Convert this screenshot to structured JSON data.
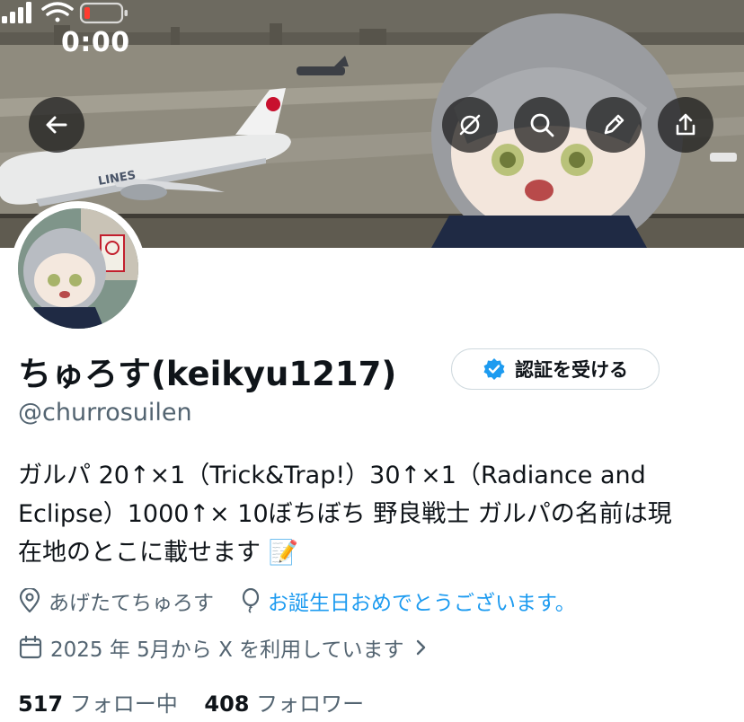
{
  "status_bar": {
    "time": "0:00",
    "icons": [
      "signal-icon",
      "wifi-icon",
      "battery-low-icon"
    ]
  },
  "header_actions": {
    "back": "back-arrow-icon",
    "grok": "grok-icon",
    "search": "search-icon",
    "edit": "pencil-icon",
    "share": "share-icon"
  },
  "banner_plane_text": "LINES",
  "profile": {
    "display_name": "ちゅろす(keikyu1217)",
    "handle": "@churrosuilen",
    "verify_label": "認証を受ける",
    "bio_lines": [
      "ガルパ 20↑×1（Trick&Trap!）30↑×1（Radiance and",
      "Eclipse）1000↑× 10ぼちぼち 野良戦士 ガルパの名前は現",
      "在地のとこに載せます 📝"
    ],
    "location": "あげたてちゅろす",
    "birthday": "お誕生日おめでとうございます。",
    "joined": "2025 年 5月から X を利用しています",
    "following_count": "517",
    "following_label": "フォロー中",
    "followers_count": "408",
    "followers_label": "フォロワー"
  },
  "colors": {
    "accent": "#1d9bf0",
    "secondary_text": "#536471",
    "primary_text": "#0f1419",
    "verify_badge": "#1d9bf0",
    "battery_low": "#ff3b30"
  }
}
